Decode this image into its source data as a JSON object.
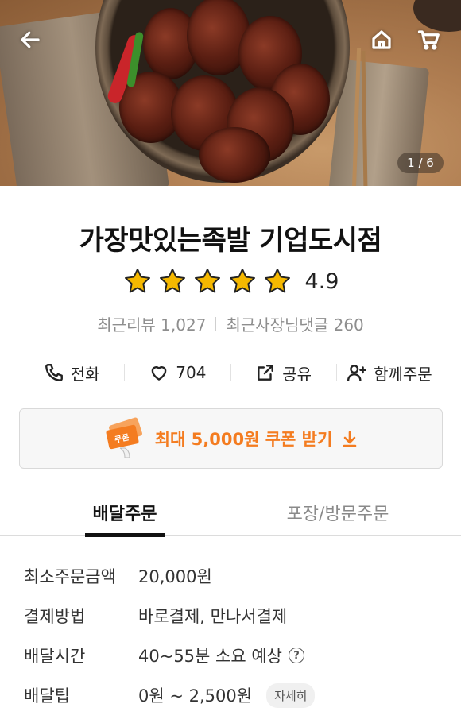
{
  "hero": {
    "counter": "1 / 6",
    "icons": {
      "back": "arrow-left-icon",
      "home": "home-icon",
      "cart": "cart-icon"
    }
  },
  "store": {
    "name": "가장맛있는족발 기업도시점",
    "rating": "4.9",
    "stars": 5,
    "star_color": "#f5b800",
    "recent_reviews": "최근리뷰 1,027",
    "owner_replies": "최근사장님댓글 260"
  },
  "actions": [
    {
      "label": "전화",
      "icon": "phone-icon"
    },
    {
      "label": "704",
      "icon": "heart-icon"
    },
    {
      "label": "공유",
      "icon": "share-icon"
    },
    {
      "label": "함께주문",
      "icon": "add-person-icon"
    }
  ],
  "coupon": {
    "label": "최대 5,000원 쿠폰 받기",
    "icon_text": "쿠폰",
    "accent": "#f47c20"
  },
  "tabs": {
    "delivery": "배달주문",
    "pickup": "포장/방문주문",
    "active": "delivery"
  },
  "info": {
    "min_order_label": "최소주문금액",
    "min_order_value": "20,000원",
    "payment_label": "결제방법",
    "payment_value": "바로결제, 만나서결제",
    "time_label": "배달시간",
    "time_value": "40~55분 소요 예상",
    "tip_label": "배달팁",
    "tip_value": "0원 ~ 2,500원",
    "tip_detail": "자세히"
  }
}
